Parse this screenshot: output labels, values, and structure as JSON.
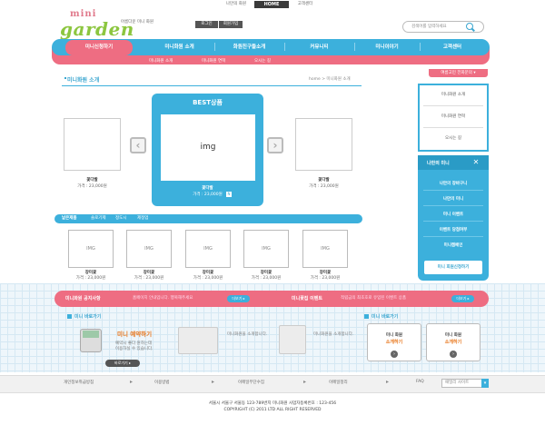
{
  "top": {
    "links": [
      "나만의 화원",
      "HOME",
      "고객센터"
    ]
  },
  "logo": {
    "mini": "mini",
    "garden": "garden",
    "tagline": "아름다운 미니 화원"
  },
  "account": {
    "login": "로그인",
    "join": "회원가입"
  },
  "search": {
    "placeholder": "검색어를 입력하세요"
  },
  "nav": {
    "home": "미니신청하기",
    "items": [
      "미니화원 소개",
      "화원친구들소개",
      "커뮤니티",
      "미니이야기",
      "고객센터"
    ],
    "sub": [
      "미니화원 소개",
      "미니화원 연혁",
      "오시는 길"
    ],
    "side_tab": "여름고민 전화문의 ▾"
  },
  "section": {
    "title": "미니화원 소개",
    "breadcrumb": "home > 미니화원 소개"
  },
  "carousel": {
    "prev": "‹",
    "next": "›",
    "left": {
      "name": "꽃다발",
      "price": "가격 : 23,000원"
    },
    "best": {
      "title": "BEST상품",
      "img": "img",
      "name": "꽃다발",
      "price": "가격 : 23,000원",
      "badge": "N"
    },
    "right": {
      "name": "꽃다발",
      "price": "가격 : 23,000원"
    }
  },
  "categories": [
    "낱은제품",
    "솔로기제",
    "정도시",
    "제정업"
  ],
  "products": [
    {
      "img": "IMG",
      "name": "장미꽃",
      "price": "가격 : 23,000원"
    },
    {
      "img": "IMG",
      "name": "장미꽃",
      "price": "가격 : 23,000원"
    },
    {
      "img": "IMG",
      "name": "장미꽃",
      "price": "가격 : 23,000원"
    },
    {
      "img": "IMG",
      "name": "장미꽃",
      "price": "가격 : 23,000원"
    },
    {
      "img": "IMG",
      "name": "장미꽃",
      "price": "가격 : 23,000원"
    }
  ],
  "sidebar": {
    "menu": [
      "미니화원 소개",
      "미니화원 연혁",
      "오시는 길"
    ],
    "panel_title": "나만의 미니",
    "close": "✕",
    "items": [
      "나만의 장바구니",
      "나만의 미니",
      "미니 이벤트",
      "이벤트 당첨여부",
      "미니캠페인"
    ],
    "button": "미니 회원신청하기"
  },
  "notice": {
    "label1": "미니화원 공지사항",
    "text1": "홈페이지 안내입니다. 행복해주세요",
    "more1": "더보기 ▸",
    "label2": "미니꽃집 이벤트",
    "text2": "적립금의 최초호로 유입된 이벤트 상품",
    "more2": "더보기 ▸"
  },
  "bottom": {
    "left_title": "미니 바로가기",
    "promo_title": "미니 예약하기",
    "promo_text1": "예약시 좋다 원하는데",
    "promo_text2": "이용하실 수 있습니다.",
    "gobtn": "바로가기 ▸",
    "ill1": "미니화원을 소개합니다.",
    "ill2": "미니화원을 소개합니다.",
    "right_title": "미니 바로가기",
    "card1_l1": "미니 화원",
    "card1_l2": "소개하기",
    "card2_l1": "미니 화원",
    "card2_l2": "소개하기",
    "go": "›"
  },
  "footer": {
    "links": [
      "개인정보취급방침",
      "이용방법",
      "이메일무단수집",
      "이메일정리",
      "FAQ"
    ],
    "family": "패밀리 사이트",
    "address": "서울시 서울구 서울동 123-789번지 미니화원 사업자등록번호 : 123-456",
    "copyright": "COPYRIGHT (C) 2011 LTD ALL RIGHT RESERVED"
  },
  "colors": {
    "blue": "#3cb0dc",
    "pink": "#ee6d82",
    "green": "#8cc63f",
    "orange": "#e8751a"
  }
}
